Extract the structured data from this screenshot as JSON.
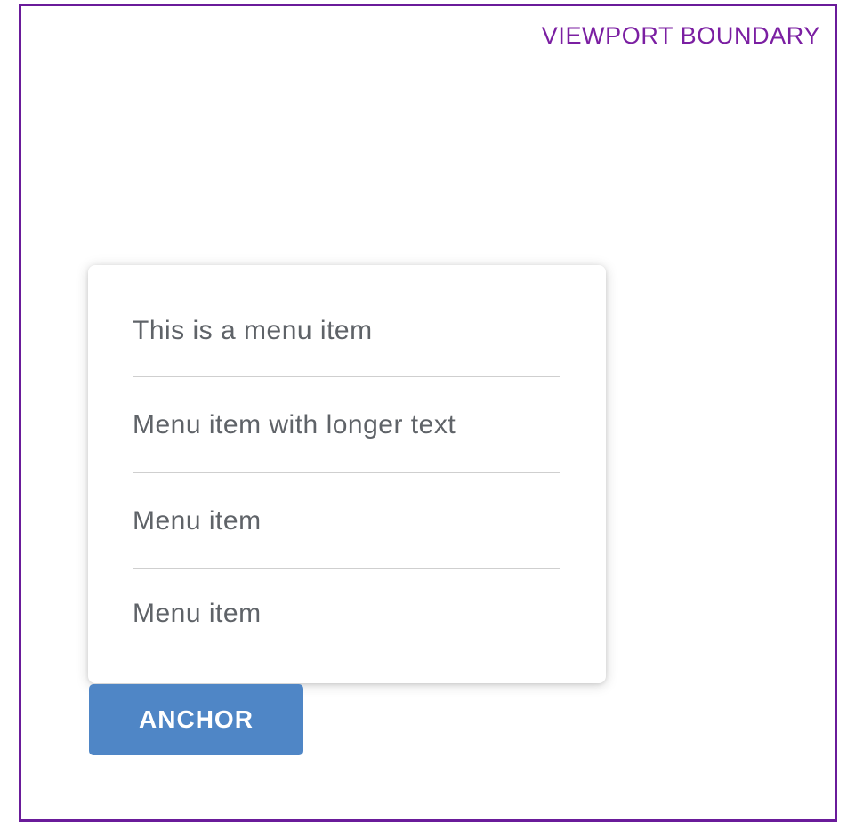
{
  "viewport": {
    "label": "VIEWPORT BOUNDARY",
    "border_color": "#6a1b9a",
    "label_color": "#7b1fa2"
  },
  "menu": {
    "items": [
      {
        "label": "This is a menu item"
      },
      {
        "label": "Menu item with longer text"
      },
      {
        "label": "Menu item"
      },
      {
        "label": "Menu item"
      }
    ],
    "text_color": "#5f6368",
    "divider_color": "#cfcfcf"
  },
  "anchor_button": {
    "label": "ANCHOR",
    "background": "#4f86c6",
    "text_color": "#ffffff"
  }
}
